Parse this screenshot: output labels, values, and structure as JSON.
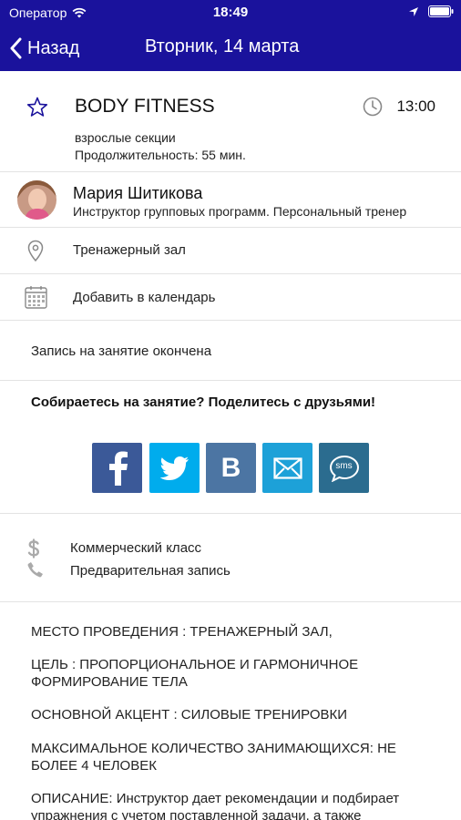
{
  "status_bar": {
    "carrier": "Оператор",
    "time": "18:49"
  },
  "nav": {
    "back_label": "Назад",
    "title": "Вторник, 14 марта"
  },
  "event": {
    "title": "BODY FITNESS",
    "time": "13:00",
    "category": "взрослые секции",
    "duration": "Продолжительность: 55 мин."
  },
  "trainer": {
    "name": "Мария Шитикова",
    "role": "Инструктор групповых программ. Персональный тренер"
  },
  "location": "Тренажерный зал",
  "calendar_label": "Добавить в календарь",
  "registration_status": "Запись на занятие окончена",
  "share": {
    "title": "Собираетесь на занятие? Поделитесь с друзьями!",
    "buttons": [
      {
        "name": "facebook",
        "color": "#3b5998",
        "glyph": "f"
      },
      {
        "name": "twitter",
        "color": "#00aced",
        "glyph": "twitter-bird-icon"
      },
      {
        "name": "vkontakte",
        "color": "#4c75a3",
        "glyph": "B"
      },
      {
        "name": "email",
        "color": "#1da1d8",
        "glyph": "envelope-icon"
      },
      {
        "name": "sms",
        "color": "#2b6c8f",
        "glyph": "sms"
      }
    ]
  },
  "info": {
    "class_type": "Коммерческий класс",
    "booking": "Предварительная запись"
  },
  "description": [
    "МЕСТО ПРОВЕДЕНИЯ : ТРЕНАЖЕРНЫЙ ЗАЛ,",
    "ЦЕЛЬ : ПРОПОРЦИОНАЛЬНОЕ И ГАРМОНИЧНОЕ ФОРМИРОВАНИЕ ТЕЛА",
    "ОСНОВНОЙ АКЦЕНТ : СИЛОВЫЕ ТРЕНИРОВКИ",
    "МАКСИМАЛЬНОЕ КОЛИЧЕСТВО ЗАНИМАЮЩИХСЯ: НЕ БОЛЕЕ 4 ЧЕЛОВЕК",
    "ОПИСАНИЕ: Инструктор дает рекомендации и подбирает упражнения с учетом поставленной задачи, а также"
  ]
}
